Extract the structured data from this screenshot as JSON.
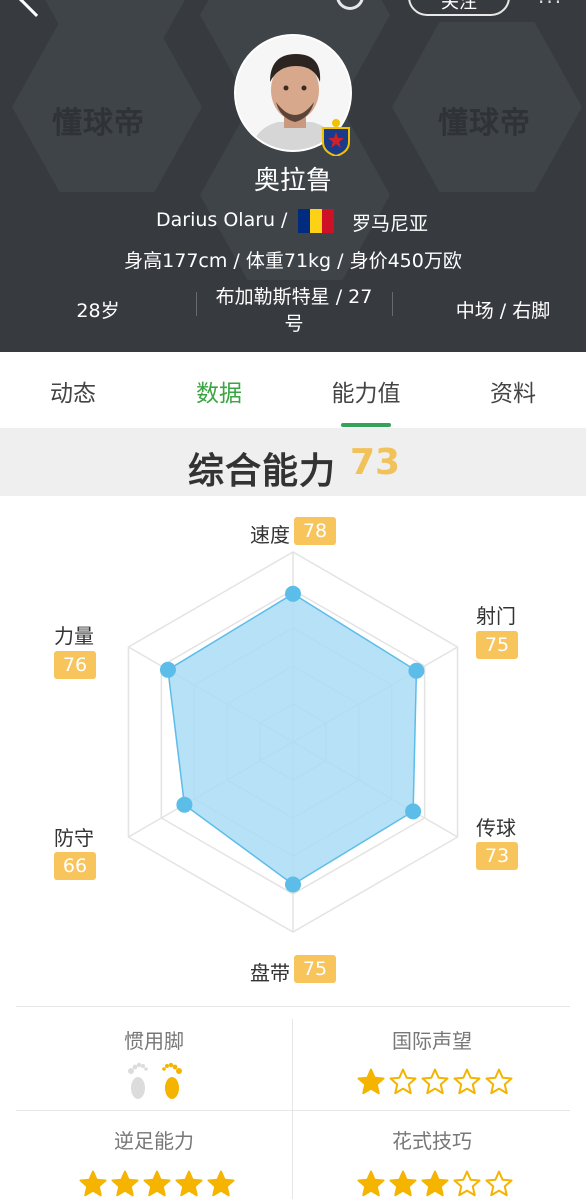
{
  "header": {
    "follow_label": "关注",
    "watermark": "懂球帝",
    "name": "奥拉鲁",
    "english_name": "Darius Olaru",
    "separator": "/",
    "nationality": "罗马尼亚",
    "body_info": "身高177cm / 体重71kg / 身价450万欧",
    "age": "28岁",
    "club_line1": "布加勒斯特星 / 27",
    "club_line2": "号",
    "position": "中场 / 右脚",
    "flag_colors": [
      "#002b7f",
      "#fcd116",
      "#ce1126"
    ]
  },
  "tabs": [
    {
      "label": "动态",
      "active": false
    },
    {
      "label": "数据",
      "active": true
    },
    {
      "label": "能力值",
      "active": false
    },
    {
      "label": "资料",
      "active": false
    }
  ],
  "overall": {
    "label": "综合能力",
    "value": "73"
  },
  "radar": {
    "attributes": [
      {
        "label": "速度",
        "value": 78
      },
      {
        "label": "射门",
        "value": 75
      },
      {
        "label": "传球",
        "value": 73
      },
      {
        "label": "盘带",
        "value": 75
      },
      {
        "label": "防守",
        "value": 66
      },
      {
        "label": "力量",
        "value": 76
      }
    ],
    "fill_color": "#a9dcf4",
    "point_color": "#5cbde9"
  },
  "traits": {
    "foot_label": "惯用脚",
    "reputation_label": "国际声望",
    "reputation_stars": 1,
    "weak_foot_label": "逆足能力",
    "weak_foot_stars": 5,
    "skill_label": "花式技巧",
    "skill_stars": 3,
    "preferred_foot": "right",
    "star_color": "#f4b400"
  }
}
